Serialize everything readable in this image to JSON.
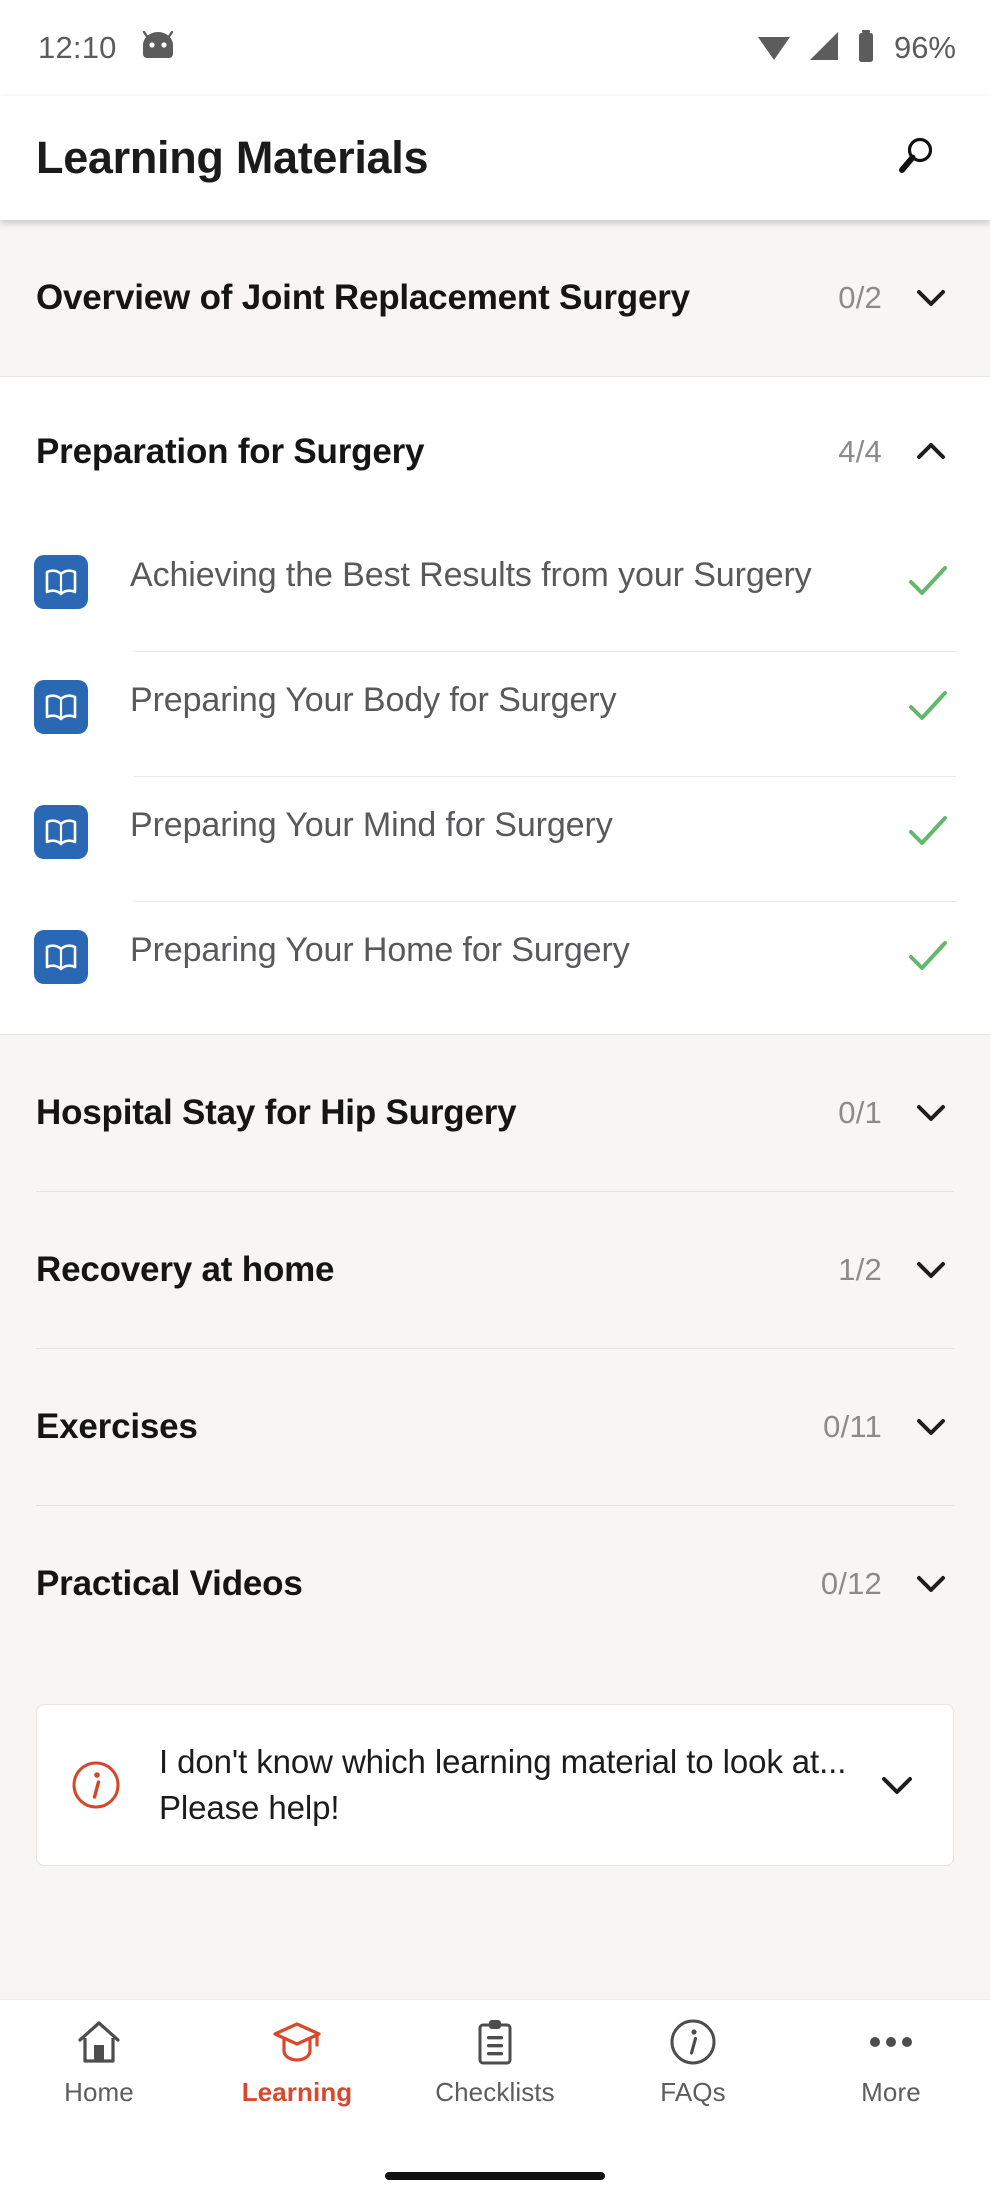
{
  "status_bar": {
    "time": "12:10",
    "battery_percent": "96%",
    "icons": [
      "android-bugdroid-icon",
      "wifi-icon",
      "cellular-signal-icon",
      "battery-icon"
    ]
  },
  "app_bar": {
    "title": "Learning Materials",
    "search_icon": "search-icon"
  },
  "colors": {
    "accent_red": "#d9472c",
    "lesson_icon_blue": "#2b68b4",
    "check_green": "#63b96b",
    "page_background": "#f7f6f4",
    "card_background": "#ffffff",
    "count_text": "#8b8b8b"
  },
  "sections": [
    {
      "title": "Overview of Joint Replacement Surgery",
      "count": "0/2",
      "expanded": false,
      "chevron": "chevron-down-icon",
      "lessons": []
    },
    {
      "title": "Preparation for Surgery",
      "count": "4/4",
      "expanded": true,
      "chevron": "chevron-up-icon",
      "lessons": [
        {
          "title": "Achieving the Best Results from your Surgery",
          "icon": "book-icon",
          "completed": true
        },
        {
          "title": "Preparing Your Body for Surgery",
          "icon": "book-icon",
          "completed": true
        },
        {
          "title": "Preparing Your Mind for Surgery",
          "icon": "book-icon",
          "completed": true
        },
        {
          "title": "Preparing Your Home for Surgery",
          "icon": "book-icon",
          "completed": true
        }
      ]
    },
    {
      "title": "Hospital Stay for Hip Surgery",
      "count": "0/1",
      "expanded": false,
      "chevron": "chevron-down-icon",
      "lessons": []
    },
    {
      "title": "Recovery at home",
      "count": "1/2",
      "expanded": false,
      "chevron": "chevron-down-icon",
      "lessons": []
    },
    {
      "title": "Exercises",
      "count": "0/11",
      "expanded": false,
      "chevron": "chevron-down-icon",
      "lessons": []
    },
    {
      "title": "Practical Videos",
      "count": "0/12",
      "expanded": false,
      "chevron": "chevron-down-icon",
      "lessons": []
    }
  ],
  "help_card": {
    "icon": "info-circle-icon",
    "text": "I don't know which learning material to look at... Please help!",
    "chevron": "chevron-down-icon"
  },
  "bottom_nav": {
    "items": [
      {
        "label": "Home",
        "icon": "home-icon",
        "active": false
      },
      {
        "label": "Learning",
        "icon": "graduation-cap-icon",
        "active": true
      },
      {
        "label": "Checklists",
        "icon": "clipboard-icon",
        "active": false
      },
      {
        "label": "FAQs",
        "icon": "info-circle-icon",
        "active": false
      },
      {
        "label": "More",
        "icon": "ellipsis-icon",
        "active": false
      }
    ]
  }
}
